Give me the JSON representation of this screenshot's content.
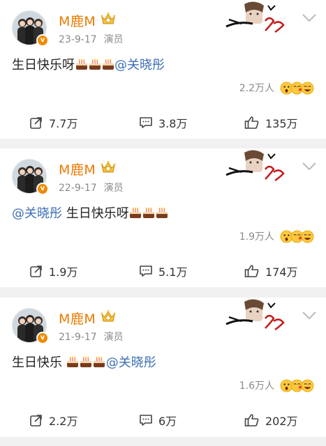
{
  "posts": [
    {
      "author": "M鹿M",
      "date": "23-9-17",
      "role": "演员",
      "text_before": "生日快乐呀",
      "cakes_before": 3,
      "mention": "@关晓彤",
      "text_after": "",
      "cakes_after": 0,
      "order": "text-cakes-mention",
      "reaction_count": "2.2万人",
      "reposts": "7.7万",
      "comments": "3.8万",
      "likes": "135万"
    },
    {
      "author": "M鹿M",
      "date": "22-9-17",
      "role": "演员",
      "mention": "@关晓彤",
      "text_after": " 生日快乐呀",
      "cakes_after": 3,
      "order": "mention-text-cakes",
      "reaction_count": "1.9万人",
      "reposts": "1.9万",
      "comments": "5.1万",
      "likes": "174万"
    },
    {
      "author": "M鹿M",
      "date": "21-9-17",
      "role": "演员",
      "text_before": "生日快乐 ",
      "cakes_before": 3,
      "mention": "@关晓彤",
      "order": "text-cakes-mention",
      "reaction_count": "1.6万人",
      "reposts": "2.2万",
      "comments": "6万",
      "likes": "202万"
    }
  ],
  "icons": {
    "verified": "verified-v-icon",
    "crown": "crown-badge-icon",
    "signature": "signature-decoration",
    "menu": "chevron-down-icon",
    "repost": "repost-icon",
    "comment": "comment-icon",
    "like": "like-icon",
    "cake": "cake-emoji-icon",
    "reactions": [
      "surprised-emoji-icon",
      "kiss-emoji-icon",
      "laugh-emoji-icon"
    ]
  },
  "colors": {
    "author": "#ec7a00",
    "mention": "#3d6fb5",
    "meta": "#8a8a8a",
    "badge": "#f08a00"
  }
}
